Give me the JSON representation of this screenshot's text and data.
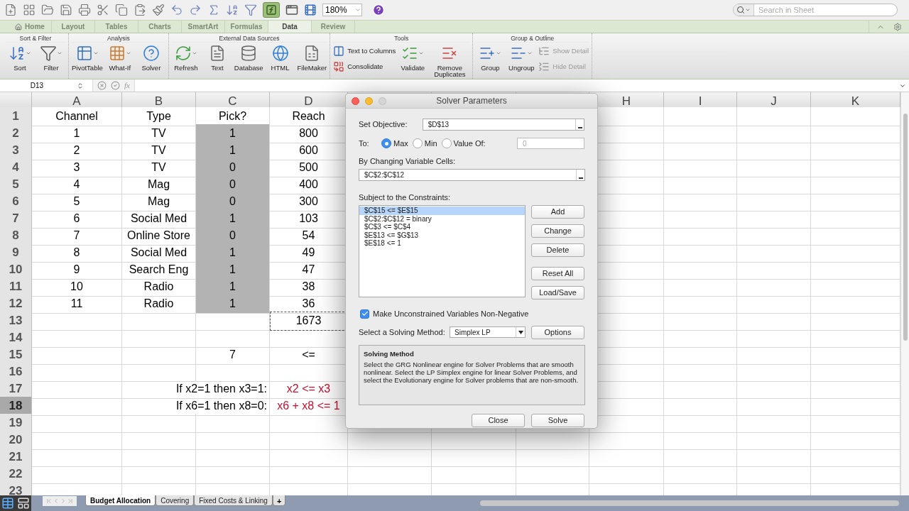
{
  "toolbar": {
    "zoom": "180%",
    "search_placeholder": "Search in Sheet"
  },
  "tabs": [
    {
      "label": "Home",
      "kind": "home",
      "selected": false
    },
    {
      "label": "Layout",
      "kind": "plain",
      "selected": false
    },
    {
      "label": "Tables",
      "kind": "plain",
      "selected": false
    },
    {
      "label": "Charts",
      "kind": "plain",
      "selected": false
    },
    {
      "label": "SmartArt",
      "kind": "plain",
      "selected": false
    },
    {
      "label": "Formulas",
      "kind": "plain",
      "selected": false
    },
    {
      "label": "Data",
      "kind": "plain",
      "selected": true
    },
    {
      "label": "Review",
      "kind": "plain",
      "selected": false
    }
  ],
  "ribbon_groups": [
    {
      "title": "Sort & Filter",
      "items": [
        {
          "label": "Sort",
          "kind": "large",
          "has_menu": true,
          "disabled": false
        },
        {
          "label": "Filter",
          "kind": "large",
          "has_menu": true,
          "disabled": false
        }
      ]
    },
    {
      "title": "Analysis",
      "items": [
        {
          "label": "PivotTable",
          "kind": "large",
          "has_menu": true,
          "disabled": false
        },
        {
          "label": "What-If",
          "kind": "large",
          "has_menu": true,
          "disabled": false
        },
        {
          "label": "Solver",
          "kind": "large",
          "has_menu": false,
          "disabled": false
        }
      ]
    },
    {
      "title": "External Data Sources",
      "items": [
        {
          "label": "Refresh",
          "kind": "large",
          "has_menu": true,
          "disabled": false
        },
        {
          "label": "Text",
          "kind": "large",
          "has_menu": false,
          "disabled": false
        },
        {
          "label": "Database",
          "kind": "large",
          "has_menu": false,
          "disabled": false
        },
        {
          "label": "HTML",
          "kind": "large",
          "has_menu": false,
          "disabled": false
        },
        {
          "label": "FileMaker",
          "kind": "large",
          "has_menu": false,
          "disabled": false
        }
      ]
    },
    {
      "title": "Tools",
      "items": [
        {
          "label": "Text to Columns",
          "kind": "small",
          "disabled": false
        },
        {
          "label": "Consolidate",
          "kind": "small",
          "disabled": false
        },
        {
          "label": "Validate",
          "kind": "large",
          "has_menu": true,
          "disabled": false
        },
        {
          "label": "Remove Duplicates",
          "kind": "large",
          "has_menu": false,
          "disabled": false
        }
      ]
    },
    {
      "title": "Group & Outline",
      "items": [
        {
          "label": "Group",
          "kind": "large",
          "has_menu": true,
          "disabled": false
        },
        {
          "label": "Ungroup",
          "kind": "large",
          "has_menu": true,
          "disabled": false
        },
        {
          "label": "Show Detail",
          "kind": "small",
          "disabled": true
        },
        {
          "label": "Hide Detail",
          "kind": "small",
          "disabled": true
        }
      ]
    }
  ],
  "formula_bar": {
    "name_box": "D13",
    "fx": "fx"
  },
  "sheet": {
    "columns_left": [
      "A",
      "B",
      "C",
      "D"
    ],
    "columns_right": [
      "H",
      "I",
      "J",
      "K"
    ],
    "rows": [
      {
        "number": "1",
        "selected": false,
        "cells": {
          "A": {
            "text": "Channel"
          },
          "B": {
            "text": "Type"
          },
          "C": {
            "text": "Pick?"
          },
          "D": {
            "text": "Reach"
          }
        }
      },
      {
        "number": "2",
        "selected": false,
        "cells": {
          "A": {
            "text": "1"
          },
          "B": {
            "text": "TV"
          },
          "C": {
            "text": "1",
            "shaded": true
          },
          "D": {
            "text": "800"
          }
        }
      },
      {
        "number": "3",
        "selected": false,
        "cells": {
          "A": {
            "text": "2"
          },
          "B": {
            "text": "TV"
          },
          "C": {
            "text": "1",
            "shaded": true
          },
          "D": {
            "text": "600"
          }
        }
      },
      {
        "number": "4",
        "selected": false,
        "cells": {
          "A": {
            "text": "3"
          },
          "B": {
            "text": "TV"
          },
          "C": {
            "text": "0",
            "shaded": true
          },
          "D": {
            "text": "500"
          }
        }
      },
      {
        "number": "5",
        "selected": false,
        "cells": {
          "A": {
            "text": "4"
          },
          "B": {
            "text": "Mag"
          },
          "C": {
            "text": "0",
            "shaded": true
          },
          "D": {
            "text": "400"
          }
        }
      },
      {
        "number": "6",
        "selected": false,
        "cells": {
          "A": {
            "text": "5"
          },
          "B": {
            "text": "Mag"
          },
          "C": {
            "text": "0",
            "shaded": true
          },
          "D": {
            "text": "300"
          }
        }
      },
      {
        "number": "7",
        "selected": false,
        "cells": {
          "A": {
            "text": "6"
          },
          "B": {
            "text": "Social Med"
          },
          "C": {
            "text": "1",
            "shaded": true
          },
          "D": {
            "text": "103"
          }
        }
      },
      {
        "number": "8",
        "selected": false,
        "cells": {
          "A": {
            "text": "7"
          },
          "B": {
            "text": "Online Store"
          },
          "C": {
            "text": "0",
            "shaded": true
          },
          "D": {
            "text": "54"
          }
        }
      },
      {
        "number": "9",
        "selected": false,
        "cells": {
          "A": {
            "text": "8"
          },
          "B": {
            "text": "Social Med"
          },
          "C": {
            "text": "1",
            "shaded": true
          },
          "D": {
            "text": "49"
          }
        }
      },
      {
        "number": "10",
        "selected": false,
        "cells": {
          "A": {
            "text": "9"
          },
          "B": {
            "text": "Search Eng"
          },
          "C": {
            "text": "1",
            "shaded": true
          },
          "D": {
            "text": "47"
          }
        }
      },
      {
        "number": "11",
        "selected": false,
        "cells": {
          "A": {
            "text": "10"
          },
          "B": {
            "text": "Radio"
          },
          "C": {
            "text": "1",
            "shaded": true
          },
          "D": {
            "text": "38"
          }
        }
      },
      {
        "number": "12",
        "selected": false,
        "cells": {
          "A": {
            "text": "11"
          },
          "B": {
            "text": "Radio"
          },
          "C": {
            "text": "1",
            "shaded": true
          },
          "D": {
            "text": "36"
          }
        }
      },
      {
        "number": "13",
        "selected": false,
        "cells": {
          "D": {
            "text": "1673",
            "marquee": true
          }
        }
      },
      {
        "number": "14",
        "selected": false
      },
      {
        "number": "15",
        "selected": false,
        "cells": {
          "C": {
            "text": "7"
          },
          "D": {
            "text": "<="
          }
        }
      },
      {
        "number": "16",
        "selected": false
      },
      {
        "number": "17",
        "selected": false,
        "cells": {
          "B": {
            "text": "If x2=1 then x3=1:",
            "kind": "wide"
          },
          "D": {
            "text": "x2 <= x3",
            "color": "#c8102e"
          }
        }
      },
      {
        "number": "18",
        "selected": true,
        "cells": {
          "B": {
            "text": "If x6=1 then x8=0:",
            "kind": "wide"
          },
          "D": {
            "text": "x6 + x8 <= 1",
            "color": "#c8102e"
          }
        }
      },
      {
        "number": "19",
        "selected": false
      },
      {
        "number": "20",
        "selected": false
      },
      {
        "number": "21",
        "selected": false
      },
      {
        "number": "22",
        "selected": false
      },
      {
        "number": "23",
        "selected": false
      }
    ]
  },
  "sheet_tabs": [
    {
      "label": "Budget Allocation",
      "selected": true
    },
    {
      "label": "Covering",
      "selected": false
    },
    {
      "label": "Fixed Costs & Linking",
      "selected": false
    }
  ],
  "add_sheet": "+",
  "dialog": {
    "title": "Solver Parameters",
    "objective_label": "Set Objective:",
    "objective": "$D$13",
    "to_label": "To:",
    "to_options": [
      {
        "label": "Max",
        "selected": true
      },
      {
        "label": "Min",
        "selected": false
      },
      {
        "label": "Value Of:",
        "selected": false
      }
    ],
    "value_of": "0",
    "changing_label": "By Changing Variable Cells:",
    "changing": "$C$2:$C$12",
    "constraints_label": "Subject to the Constraints:",
    "constraints": [
      {
        "text": "$C$15 <= $E$15",
        "selected": true
      },
      {
        "text": "$C$2:$C$12 = binary",
        "selected": false
      },
      {
        "text": "$C$3 <= $C$4",
        "selected": false
      },
      {
        "text": "$E$13 <= $G$13",
        "selected": false
      },
      {
        "text": "$E$18 <= 1",
        "selected": false
      }
    ],
    "side_buttons": [
      "Add",
      "Change",
      "Delete",
      "Reset All",
      "Load/Save"
    ],
    "nonneg": {
      "label": "Make Unconstrained Variables Non-Negative",
      "checked": true
    },
    "method_label": "Select a Solving Method:",
    "method": "Simplex LP",
    "options_button": "Options",
    "description_title": "Solving Method",
    "description": "Select the GRG Nonlinear engine for Solver Problems that are smooth nonlinear. Select the LP Simplex engine for linear Solver Problems, and select the Evolutionary engine for Solver problems that are non-smooth.",
    "footer_buttons": [
      "Close",
      "Solve"
    ]
  }
}
